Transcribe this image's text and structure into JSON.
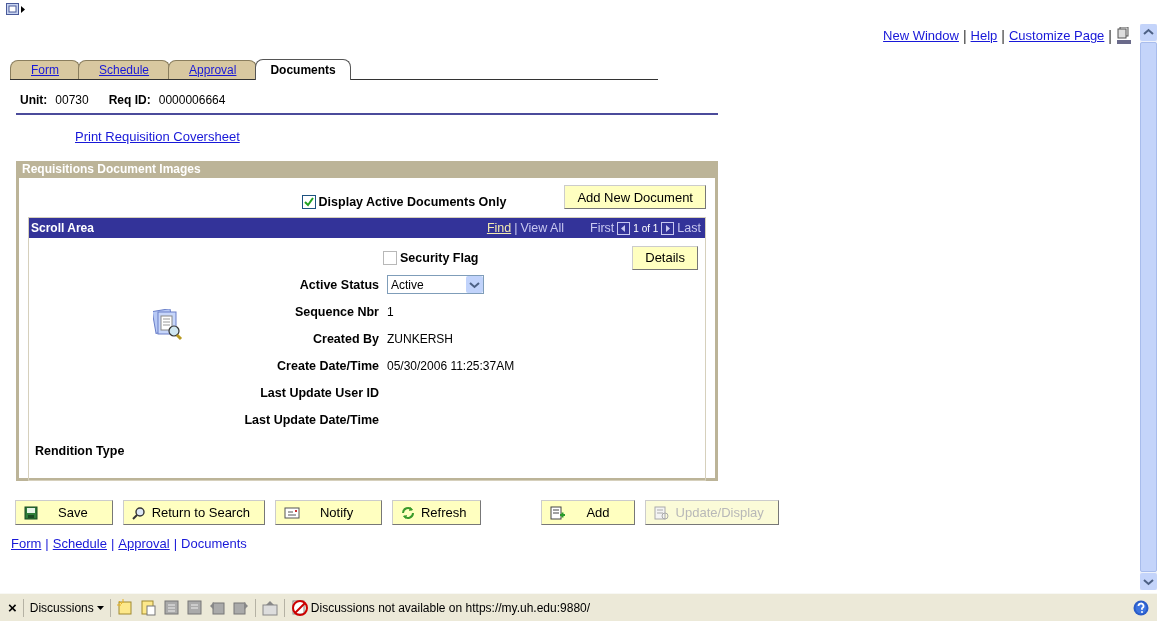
{
  "top_links": {
    "items": [
      "New Window",
      "Help",
      "Customize Page"
    ],
    "separator": "|"
  },
  "tabs": [
    {
      "label": "Form",
      "selected": false
    },
    {
      "label": "Schedule",
      "selected": false
    },
    {
      "label": "Approval",
      "selected": false
    },
    {
      "label": "Documents",
      "selected": true
    }
  ],
  "header_fields": [
    {
      "label": "Unit:",
      "value": "00730"
    },
    {
      "label": "Req ID:",
      "value": "0000006664"
    }
  ],
  "print_link": "Print Requisition Coversheet",
  "group": {
    "title": "Requisitions Document Images",
    "display_active": {
      "label": "Display Active Documents Only",
      "checked": true
    },
    "add_button": "Add New Document",
    "scroll_area": {
      "title": "Scroll Area",
      "find": "Find",
      "separator": "|",
      "view_all": "View All",
      "first": "First",
      "count": "1 of 1",
      "last": "Last",
      "security_flag": {
        "label": "Security Flag",
        "checked": false
      },
      "details_button": "Details",
      "fields": [
        {
          "kind": "select",
          "label": "Active Status",
          "value": "Active"
        },
        {
          "kind": "text",
          "label": "Sequence Nbr",
          "value": "1"
        },
        {
          "kind": "text",
          "label": "Created By",
          "value": "ZUNKERSH"
        },
        {
          "kind": "text",
          "label": "Create Date/Time",
          "value": "05/30/2006 11:25:37AM"
        },
        {
          "kind": "text",
          "label": "Last Update User ID"
        },
        {
          "kind": "text",
          "label": "Last Update Date/Time"
        }
      ],
      "rendition_label": "Rendition Type"
    }
  },
  "button_groups": [
    {
      "buttons": [
        {
          "kind": "save",
          "label": "Save",
          "disabled": false
        },
        {
          "kind": "search",
          "label": "Return to Search",
          "disabled": false
        },
        {
          "kind": "notify",
          "label": "Notify",
          "disabled": false
        },
        {
          "kind": "refresh",
          "label": "Refresh",
          "disabled": false
        }
      ]
    },
    {
      "buttons": [
        {
          "kind": "add",
          "label": "Add",
          "disabled": false
        },
        {
          "kind": "update",
          "label": "Update/Display",
          "disabled": true
        }
      ]
    }
  ],
  "bottom_links": {
    "items": [
      "Form",
      "Schedule",
      "Approval",
      "Documents"
    ],
    "separator": "|"
  },
  "discussion_bar": {
    "close": "×",
    "menu": "Discussions",
    "message": "Discussions not available on https://my.uh.edu:9880/"
  }
}
